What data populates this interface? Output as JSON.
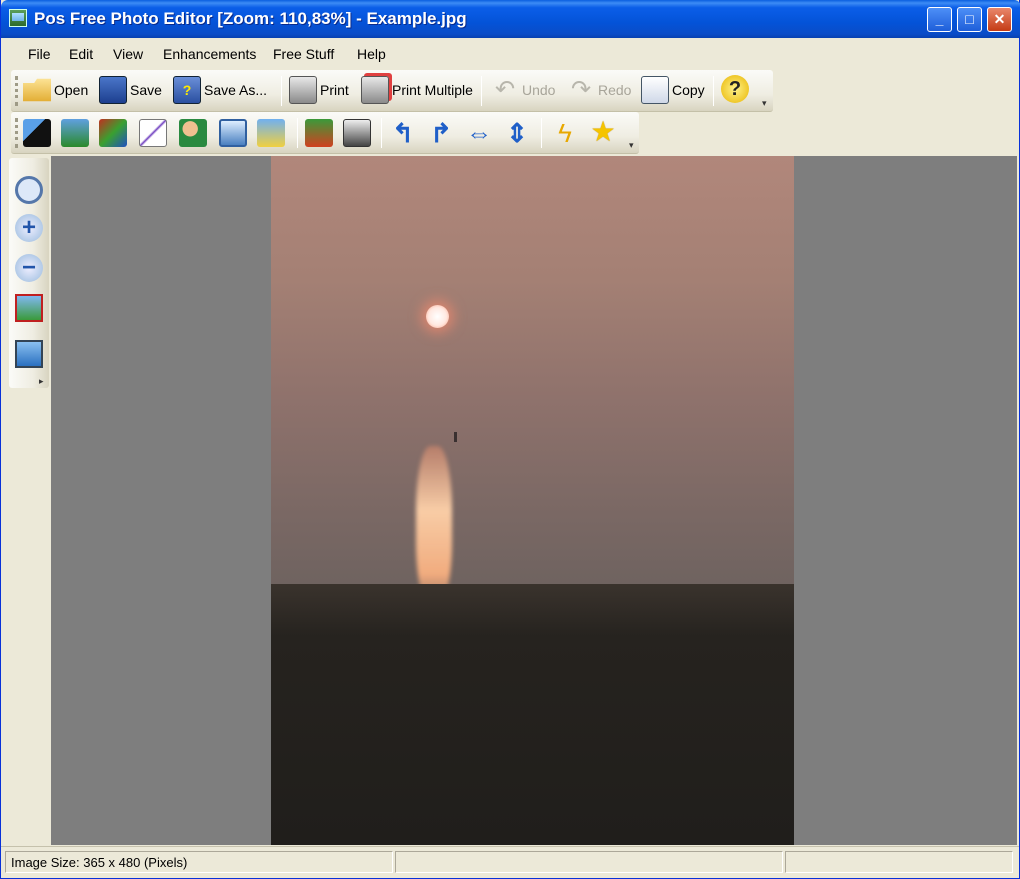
{
  "window": {
    "title": "Pos Free Photo Editor [Zoom: 110,83%] - Example.jpg",
    "buttons": {
      "minimize": "_",
      "maximize": "□",
      "close": "✕"
    }
  },
  "menu": [
    "File",
    "Edit",
    "View",
    "Enhancements",
    "Free Stuff",
    "Help"
  ],
  "toolbar_main": {
    "open": "Open",
    "save": "Save",
    "save_as": "Save As...",
    "print": "Print",
    "print_multiple": "Print Multiple",
    "undo": "Undo",
    "redo": "Redo",
    "copy": "Copy"
  },
  "toolbar_effects_icons": [
    "brightness-contrast-icon",
    "color-balance-icon",
    "hue-saturation-icon",
    "curves-icon",
    "red-eye-icon",
    "levels-icon",
    "auto-enhance-icon",
    "sharpen-icon",
    "grayscale-icon",
    "rotate-left-icon",
    "rotate-right-icon",
    "flip-horizontal-icon",
    "flip-vertical-icon",
    "effects-lightning-icon",
    "favorite-star-icon"
  ],
  "left_toolbar_icons": [
    "zoom-fit-icon",
    "zoom-in-icon",
    "zoom-out-icon",
    "actual-size-icon",
    "fullscreen-icon"
  ],
  "status": {
    "image_size": "Image Size: 365 x 480 (Pixels)",
    "cell2": "",
    "cell3": ""
  },
  "colors": {
    "titlebar": "#0453d8",
    "canvas_bg": "#7e7e7e",
    "chrome": "#ece9d8"
  }
}
